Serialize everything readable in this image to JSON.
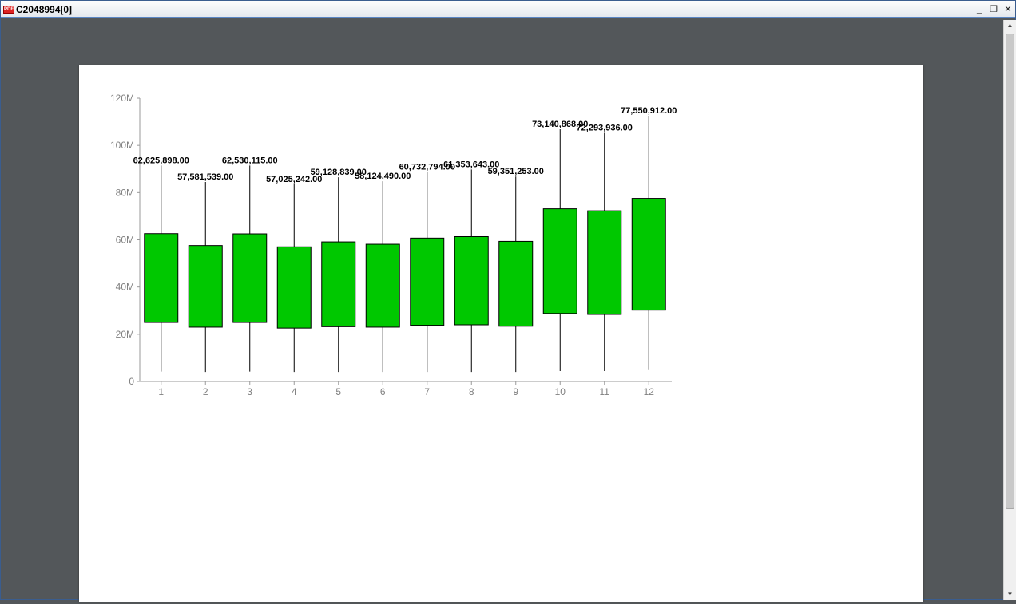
{
  "window": {
    "title": "C2048994[0]",
    "icon": "pdf-document-icon",
    "minimize_glyph": "_",
    "maximize_glyph": "❐",
    "close_glyph": "✕"
  },
  "scrollbar": {
    "up_glyph": "▲",
    "down_glyph": "▼"
  },
  "colors": {
    "box_fill": "#00c800",
    "axis": "#9a9a9a",
    "tick_text": "#808080",
    "page_bg": "#53575a"
  },
  "chart_data": {
    "type": "boxplot",
    "categories": [
      "1",
      "2",
      "3",
      "4",
      "5",
      "6",
      "7",
      "8",
      "9",
      "10",
      "11",
      "12"
    ],
    "ylim": [
      0,
      120000000
    ],
    "yticks": [
      0,
      20000000,
      40000000,
      60000000,
      80000000,
      100000000,
      120000000
    ],
    "ytick_labels": [
      "0",
      "20M",
      "40M",
      "60M",
      "80M",
      "100M",
      "120M"
    ],
    "title": "",
    "xlabel": "",
    "ylabel": "",
    "grid": false,
    "boxes": [
      {
        "category": "1",
        "whisker_low": 4200000,
        "q1": 25000000,
        "q3": 62625898,
        "whisker_high": 91500000,
        "label": "62,625,898.00"
      },
      {
        "category": "2",
        "whisker_low": 4000000,
        "q1": 23000000,
        "q3": 57581539,
        "whisker_high": 84500000,
        "label": "57,581,539.00"
      },
      {
        "category": "3",
        "whisker_low": 4200000,
        "q1": 25000000,
        "q3": 62530115,
        "whisker_high": 91500000,
        "label": "62,530,115.00"
      },
      {
        "category": "4",
        "whisker_low": 4000000,
        "q1": 22600000,
        "q3": 57025242,
        "whisker_high": 83500000,
        "label": "57,025,242.00"
      },
      {
        "category": "5",
        "whisker_low": 4000000,
        "q1": 23200000,
        "q3": 59128839,
        "whisker_high": 86500000,
        "label": "59,128,839.00"
      },
      {
        "category": "6",
        "whisker_low": 4000000,
        "q1": 23000000,
        "q3": 58124490,
        "whisker_high": 84800000,
        "label": "58,124,490.00"
      },
      {
        "category": "7",
        "whisker_low": 4000000,
        "q1": 23800000,
        "q3": 60732794,
        "whisker_high": 88800000,
        "label": "60,732,794.00"
      },
      {
        "category": "8",
        "whisker_low": 4000000,
        "q1": 24000000,
        "q3": 61353643,
        "whisker_high": 89800000,
        "label": "61,353,643.00"
      },
      {
        "category": "9",
        "whisker_low": 4000000,
        "q1": 23400000,
        "q3": 59351253,
        "whisker_high": 86800000,
        "label": "59,351,253.00"
      },
      {
        "category": "10",
        "whisker_low": 4400000,
        "q1": 28800000,
        "q3": 73140868,
        "whisker_high": 106800000,
        "label": "73,140,868.00"
      },
      {
        "category": "11",
        "whisker_low": 4400000,
        "q1": 28400000,
        "q3": 72293936,
        "whisker_high": 105300000,
        "label": "72,293,936.00"
      },
      {
        "category": "12",
        "whisker_low": 4800000,
        "q1": 30200000,
        "q3": 77550912,
        "whisker_high": 112500000,
        "label": "77,550,912.00"
      }
    ]
  }
}
